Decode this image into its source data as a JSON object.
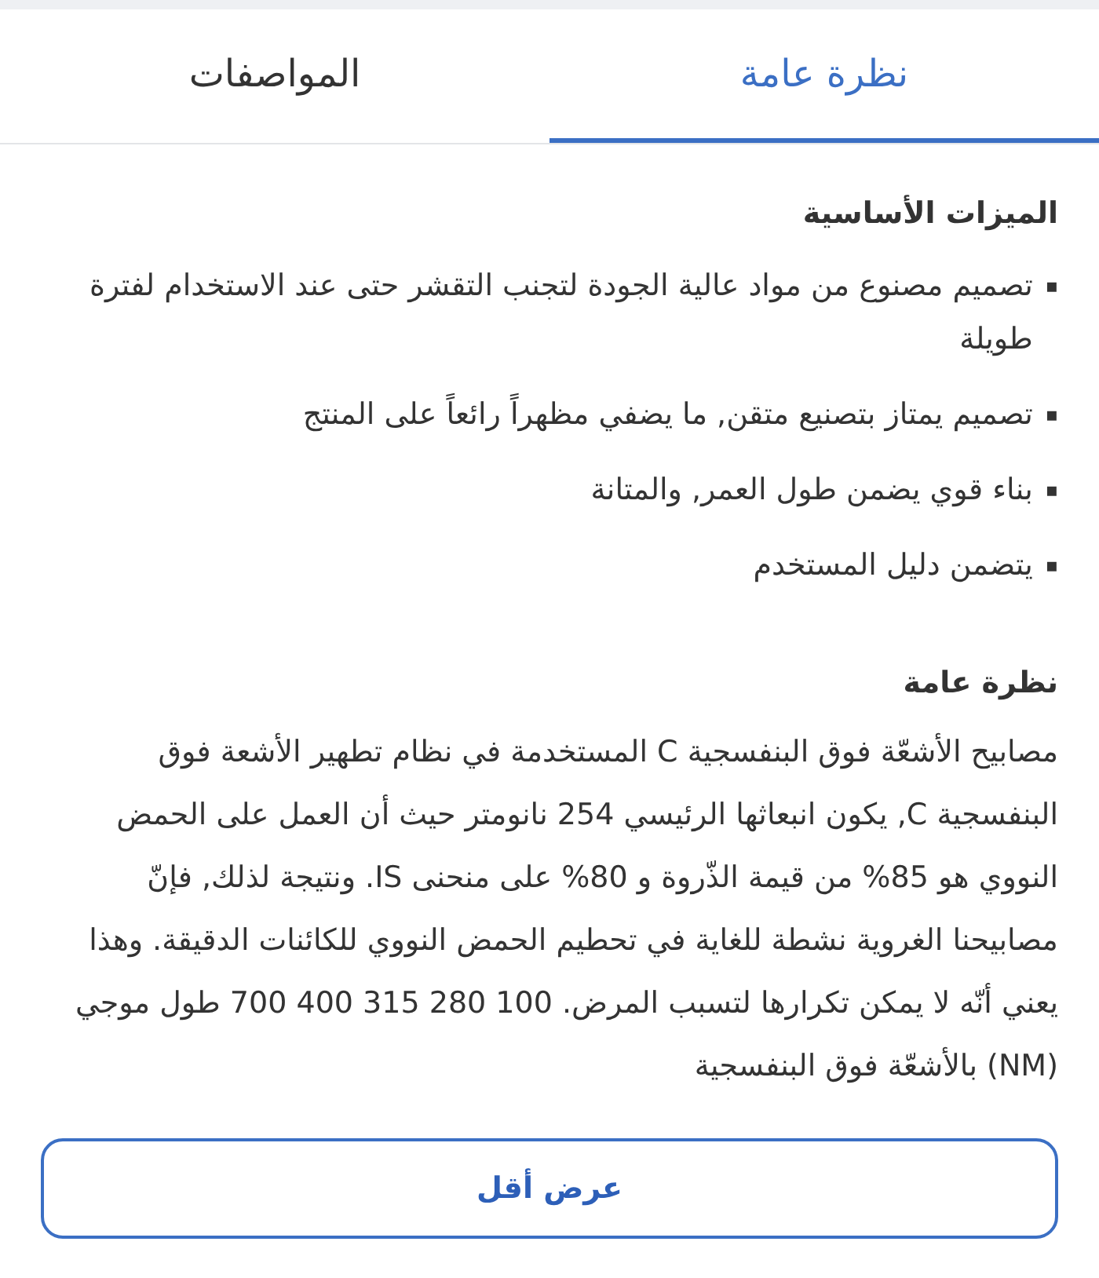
{
  "tabs": [
    {
      "label": "نظرة عامة",
      "selected": true
    },
    {
      "label": "المواصفات",
      "selected": false
    }
  ],
  "features": {
    "heading": "الميزات الأساسية",
    "items": [
      {
        "marker": "▪",
        "text": "تصميم مصنوع من مواد عالية الجودة لتجنب التقشر حتى عند الاستخدام لفترة طويلة"
      },
      {
        "marker": "▪",
        "text": "تصميم يمتاز بتصنيع متقن, ما يضفي مظهراً رائعاً على المنتج"
      },
      {
        "marker": "▪",
        "text": "بناء قوي يضمن طول العمر, والمتانة"
      },
      {
        "marker": "▪",
        "text": "يتضمن دليل المستخدم"
      }
    ]
  },
  "overview": {
    "heading": "نظرة عامة",
    "text": "مصابيح الأشعّة فوق البنفسجية C المستخدمة في نظام تطهير الأشعة فوق البنفسجية C, يكون انبعاثها الرئيسي 254 نانومتر حيث أن العمل على الحمض النووي هو 85% من قيمة الذّروة و 80% على منحنى IS. ونتيجة لذلك, فإنّ مصابيحنا الغروية نشطة للغاية في تحطيم الحمض النووي للكائنات الدقيقة. وهذا يعني أنّه لا يمكن تكرارها لتسبب المرض. 100 280 315 400 700 طول موجي (NM) بالأشعّة فوق البنفسجية"
  },
  "button": {
    "label": "عرض أقل"
  }
}
